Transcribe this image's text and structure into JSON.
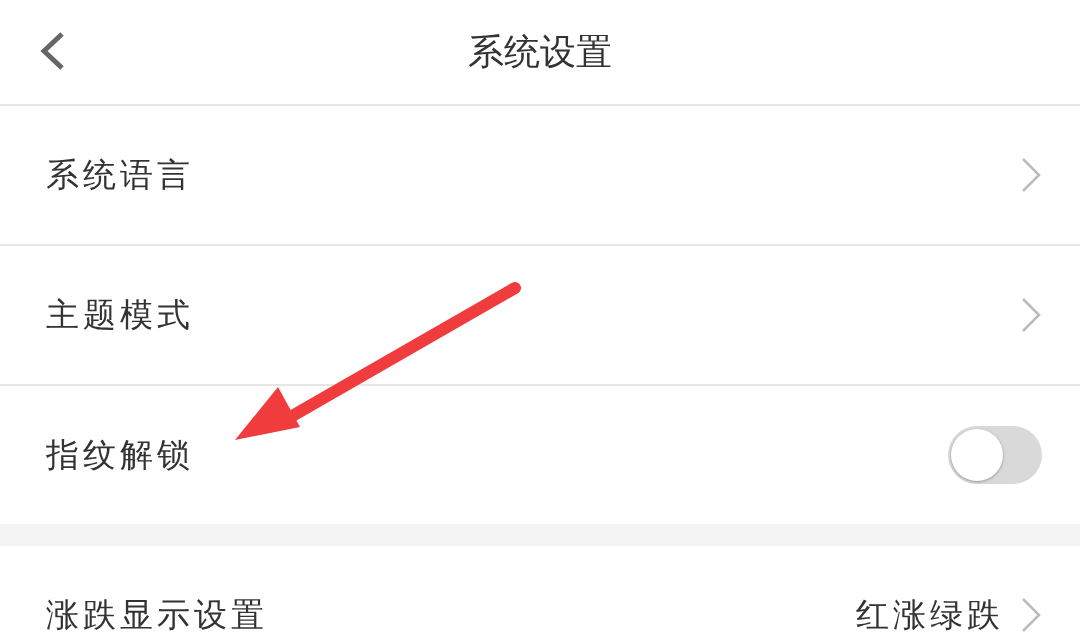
{
  "header": {
    "title": "系统设置"
  },
  "sections": [
    {
      "rows": [
        {
          "kind": "link",
          "label": "系统语言"
        },
        {
          "kind": "link",
          "label": "主题模式"
        },
        {
          "kind": "toggle",
          "label": "指纹解锁",
          "on": false
        }
      ]
    },
    {
      "rows": [
        {
          "kind": "value",
          "label": "涨跌显示设置",
          "value": "红涨绿跌"
        }
      ]
    }
  ]
}
